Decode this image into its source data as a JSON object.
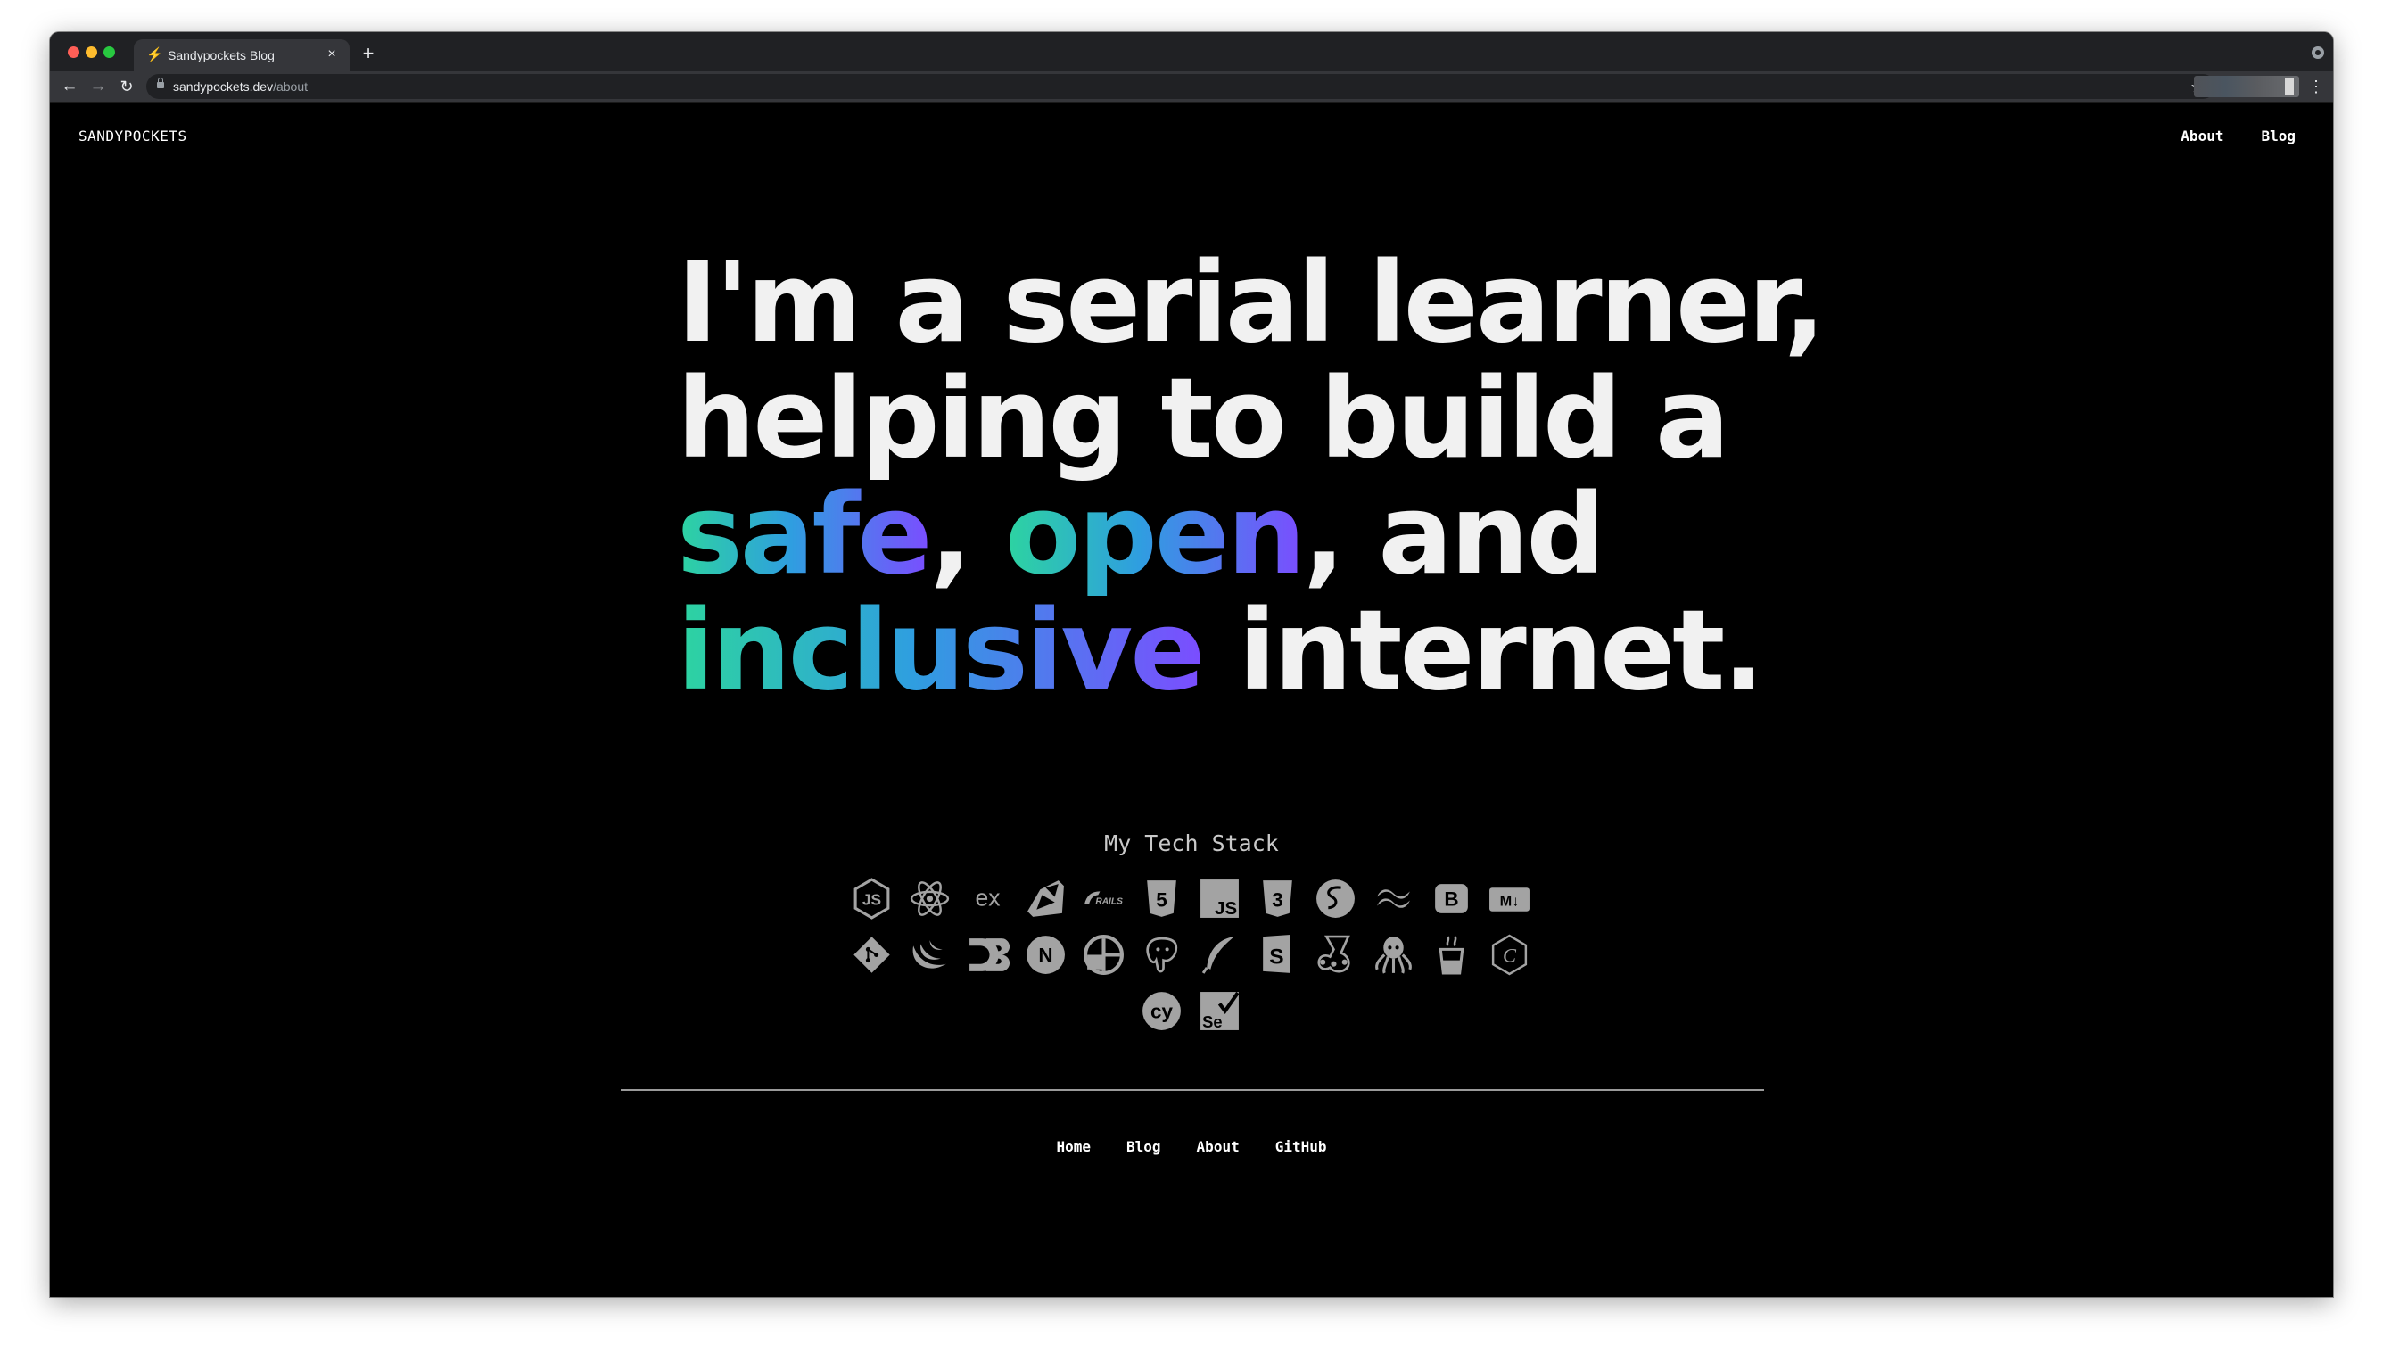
{
  "browser": {
    "tab_title": "Sandypockets Blog",
    "tab_favicon": "⚡",
    "tab_close": "×",
    "new_tab": "+",
    "url_host": "sandypockets.dev",
    "url_path": "/about",
    "back": "←",
    "forward": "→",
    "reload": "↻",
    "bookmark": "☆",
    "menu": "⋮"
  },
  "site": {
    "logo": "SANDYPOCKETS",
    "nav": [
      {
        "label": "About"
      },
      {
        "label": "Blog"
      }
    ]
  },
  "hero": {
    "line1": "I'm a serial learner,",
    "line2": "helping to build a",
    "line3_word1": "safe",
    "line3_sep1": ", ",
    "line3_word2": "open",
    "line3_rest": ", and",
    "line4_word": "inclusive",
    "line4_rest": " internet.",
    "gradient_colors": [
      "#2dd4a0",
      "#2f9ee0",
      "#7b4dff"
    ]
  },
  "tech_stack": {
    "title": "My Tech Stack",
    "icons": [
      {
        "name": "nodejs-icon",
        "glyph": "JS"
      },
      {
        "name": "react-icon",
        "glyph": ""
      },
      {
        "name": "express-icon",
        "glyph": "ex"
      },
      {
        "name": "ruby-icon",
        "glyph": ""
      },
      {
        "name": "rails-icon",
        "glyph": "RAILS"
      },
      {
        "name": "html5-icon",
        "glyph": "5"
      },
      {
        "name": "javascript-icon",
        "glyph": "JS"
      },
      {
        "name": "css3-icon",
        "glyph": "3"
      },
      {
        "name": "sass-icon",
        "glyph": "S"
      },
      {
        "name": "tailwind-icon",
        "glyph": "~"
      },
      {
        "name": "bootstrap-icon",
        "glyph": "B"
      },
      {
        "name": "markdown-icon",
        "glyph": "M↓"
      },
      {
        "name": "git-icon",
        "glyph": ""
      },
      {
        "name": "jquery-icon",
        "glyph": ""
      },
      {
        "name": "d3-icon",
        "glyph": "D3"
      },
      {
        "name": "nextjs-icon",
        "glyph": "N"
      },
      {
        "name": "metabase-icon",
        "glyph": ""
      },
      {
        "name": "postgresql-icon",
        "glyph": ""
      },
      {
        "name": "feather-icon",
        "glyph": ""
      },
      {
        "name": "storybook-icon",
        "glyph": "S"
      },
      {
        "name": "jest-icon",
        "glyph": ""
      },
      {
        "name": "octopus-icon",
        "glyph": ""
      },
      {
        "name": "coffee-icon",
        "glyph": ""
      },
      {
        "name": "codeigniter-icon",
        "glyph": "C"
      },
      {
        "name": "cypress-icon",
        "glyph": "cy"
      },
      {
        "name": "selenium-icon",
        "glyph": "Se"
      }
    ]
  },
  "footer": {
    "links": [
      {
        "label": "Home"
      },
      {
        "label": "Blog"
      },
      {
        "label": "About"
      },
      {
        "label": "GitHub"
      }
    ]
  }
}
